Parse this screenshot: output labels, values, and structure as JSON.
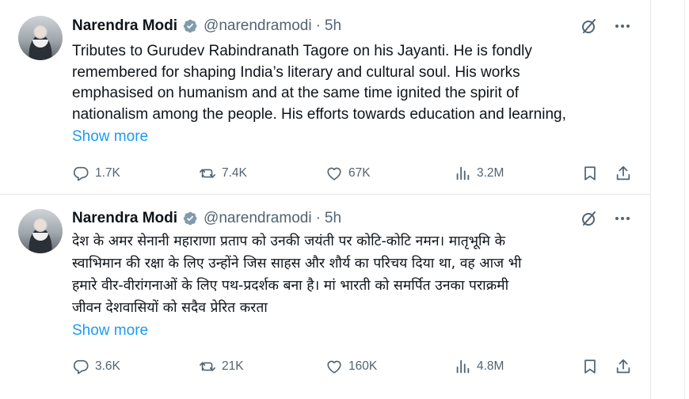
{
  "tweets": [
    {
      "author": "Narendra Modi",
      "handle": "@narendramodi",
      "separator": "·",
      "time": "5h",
      "text": "Tributes to Gurudev Rabindranath Tagore on his Jayanti. He is fondly\nremembered for shaping India’s literary and cultural soul. His works\nemphasised on humanism and at the same time ignited the spirit of\nnationalism among the people. His efforts towards education and learning,",
      "show_more": "Show more",
      "stats": {
        "replies": "1.7K",
        "reposts": "7.4K",
        "likes": "67K",
        "views": "3.2M"
      }
    },
    {
      "author": "Narendra Modi",
      "handle": "@narendramodi",
      "separator": "·",
      "time": "5h",
      "text": "देश के अमर सेनानी महाराणा प्रताप को उनकी जयंती पर कोटि-कोटि नमन। मातृभूमि के\nस्वाभिमान की रक्षा के लिए उन्होंने जिस साहस और शौर्य का परिचय दिया था, वह आज भी\nहमारे वीर-वीरांगनाओं के लिए पथ-प्रदर्शक बना है। मां भारती को समर्पित उनका पराक्रमी\nजीवन देशवासियों को सदैव प्रेरित करता",
      "show_more": "Show more",
      "stats": {
        "replies": "3.6K",
        "reposts": "21K",
        "likes": "160K",
        "views": "4.8M"
      }
    }
  ],
  "icons": [
    "verified-badge-icon",
    "grok-icon",
    "more-icon",
    "reply-icon",
    "repost-icon",
    "like-icon",
    "views-icon",
    "bookmark-icon",
    "share-icon"
  ],
  "colors": {
    "accent": "#1d9bf0",
    "muted": "#536471",
    "text": "#0f1419",
    "badge": "#829aab"
  }
}
